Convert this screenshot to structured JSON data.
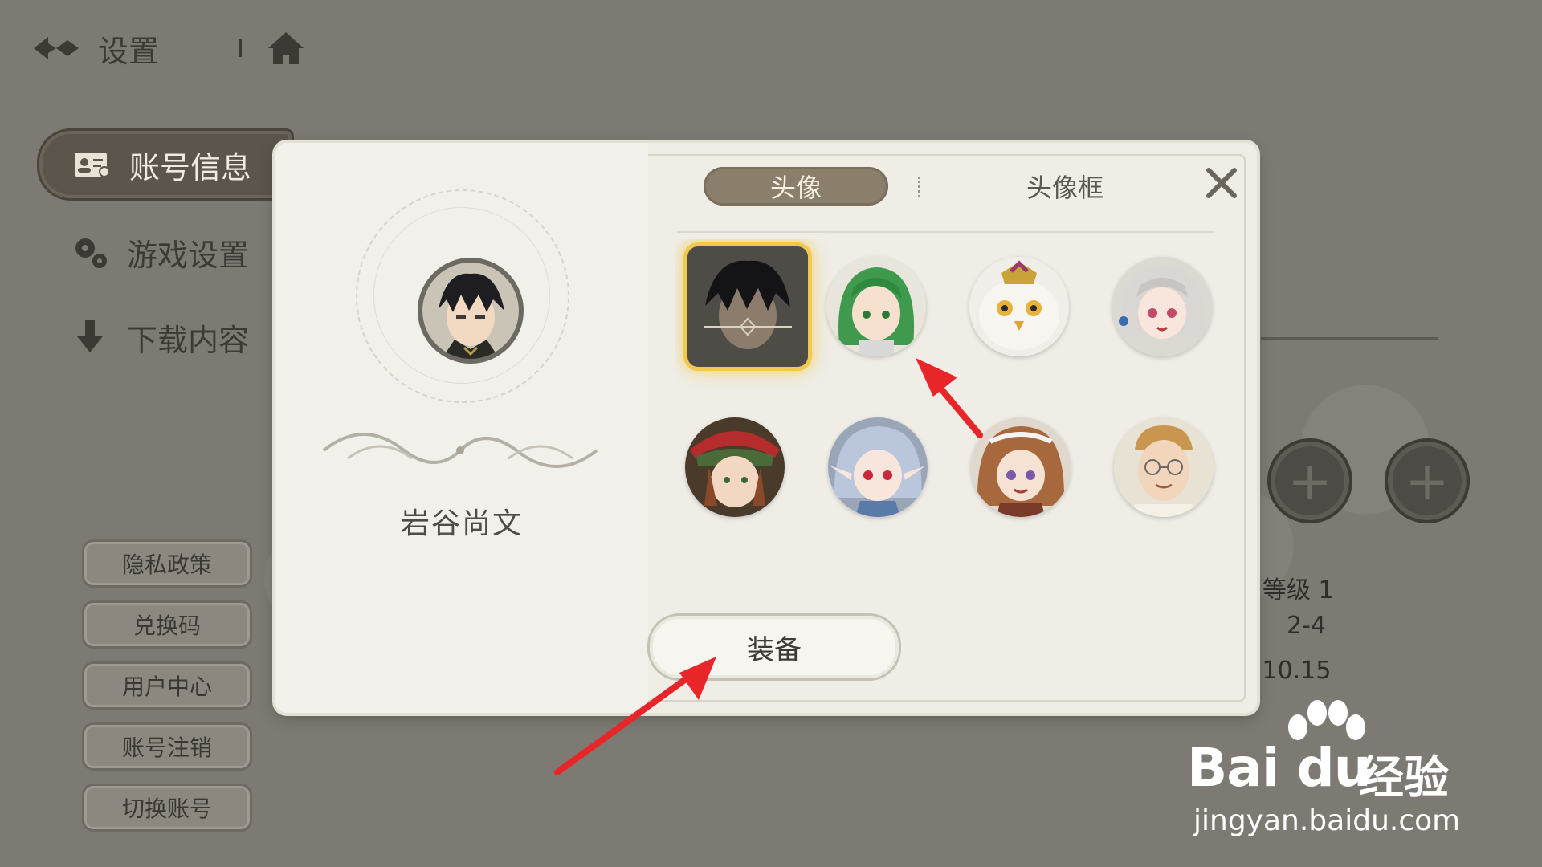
{
  "topbar": {
    "title": "设置",
    "back_icon": "back-arrow-icon",
    "home_icon": "home-icon"
  },
  "sidebar": {
    "items": [
      {
        "label": "账号信息",
        "icon": "id-card-icon",
        "active": true
      },
      {
        "label": "游戏设置",
        "icon": "gears-icon",
        "active": false
      },
      {
        "label": "下载内容",
        "icon": "download-icon",
        "active": false
      }
    ]
  },
  "small_buttons": [
    "隐私政策",
    "兑换码",
    "用户中心",
    "账号注销",
    "切换账号"
  ],
  "background_info": {
    "level": "等级 1",
    "line2": "2-4",
    "line3": ".10.15"
  },
  "modal": {
    "player_name": "岩谷尚文",
    "tabs": {
      "active": "头像",
      "inactive": "头像框"
    },
    "equip_label": "装备",
    "avatars": [
      {
        "name": "dark-hair-male",
        "selected": true
      },
      {
        "name": "green-hair-girl",
        "selected": false
      },
      {
        "name": "white-owl-creature",
        "selected": false
      },
      {
        "name": "silver-hair-girl",
        "selected": false
      },
      {
        "name": "red-hat-girl",
        "selected": false
      },
      {
        "name": "blue-hair-elf-girl",
        "selected": false
      },
      {
        "name": "brown-hair-girl",
        "selected": false
      },
      {
        "name": "old-man-glasses",
        "selected": false
      }
    ]
  },
  "watermark": {
    "brand": "Bai du",
    "brand_cn": "经验",
    "url": "jingyan.baidu.com"
  },
  "colors": {
    "accent_gold": "#f2c94c",
    "tab_active": "#8b7f6c",
    "annotation_red": "#e8262a"
  }
}
